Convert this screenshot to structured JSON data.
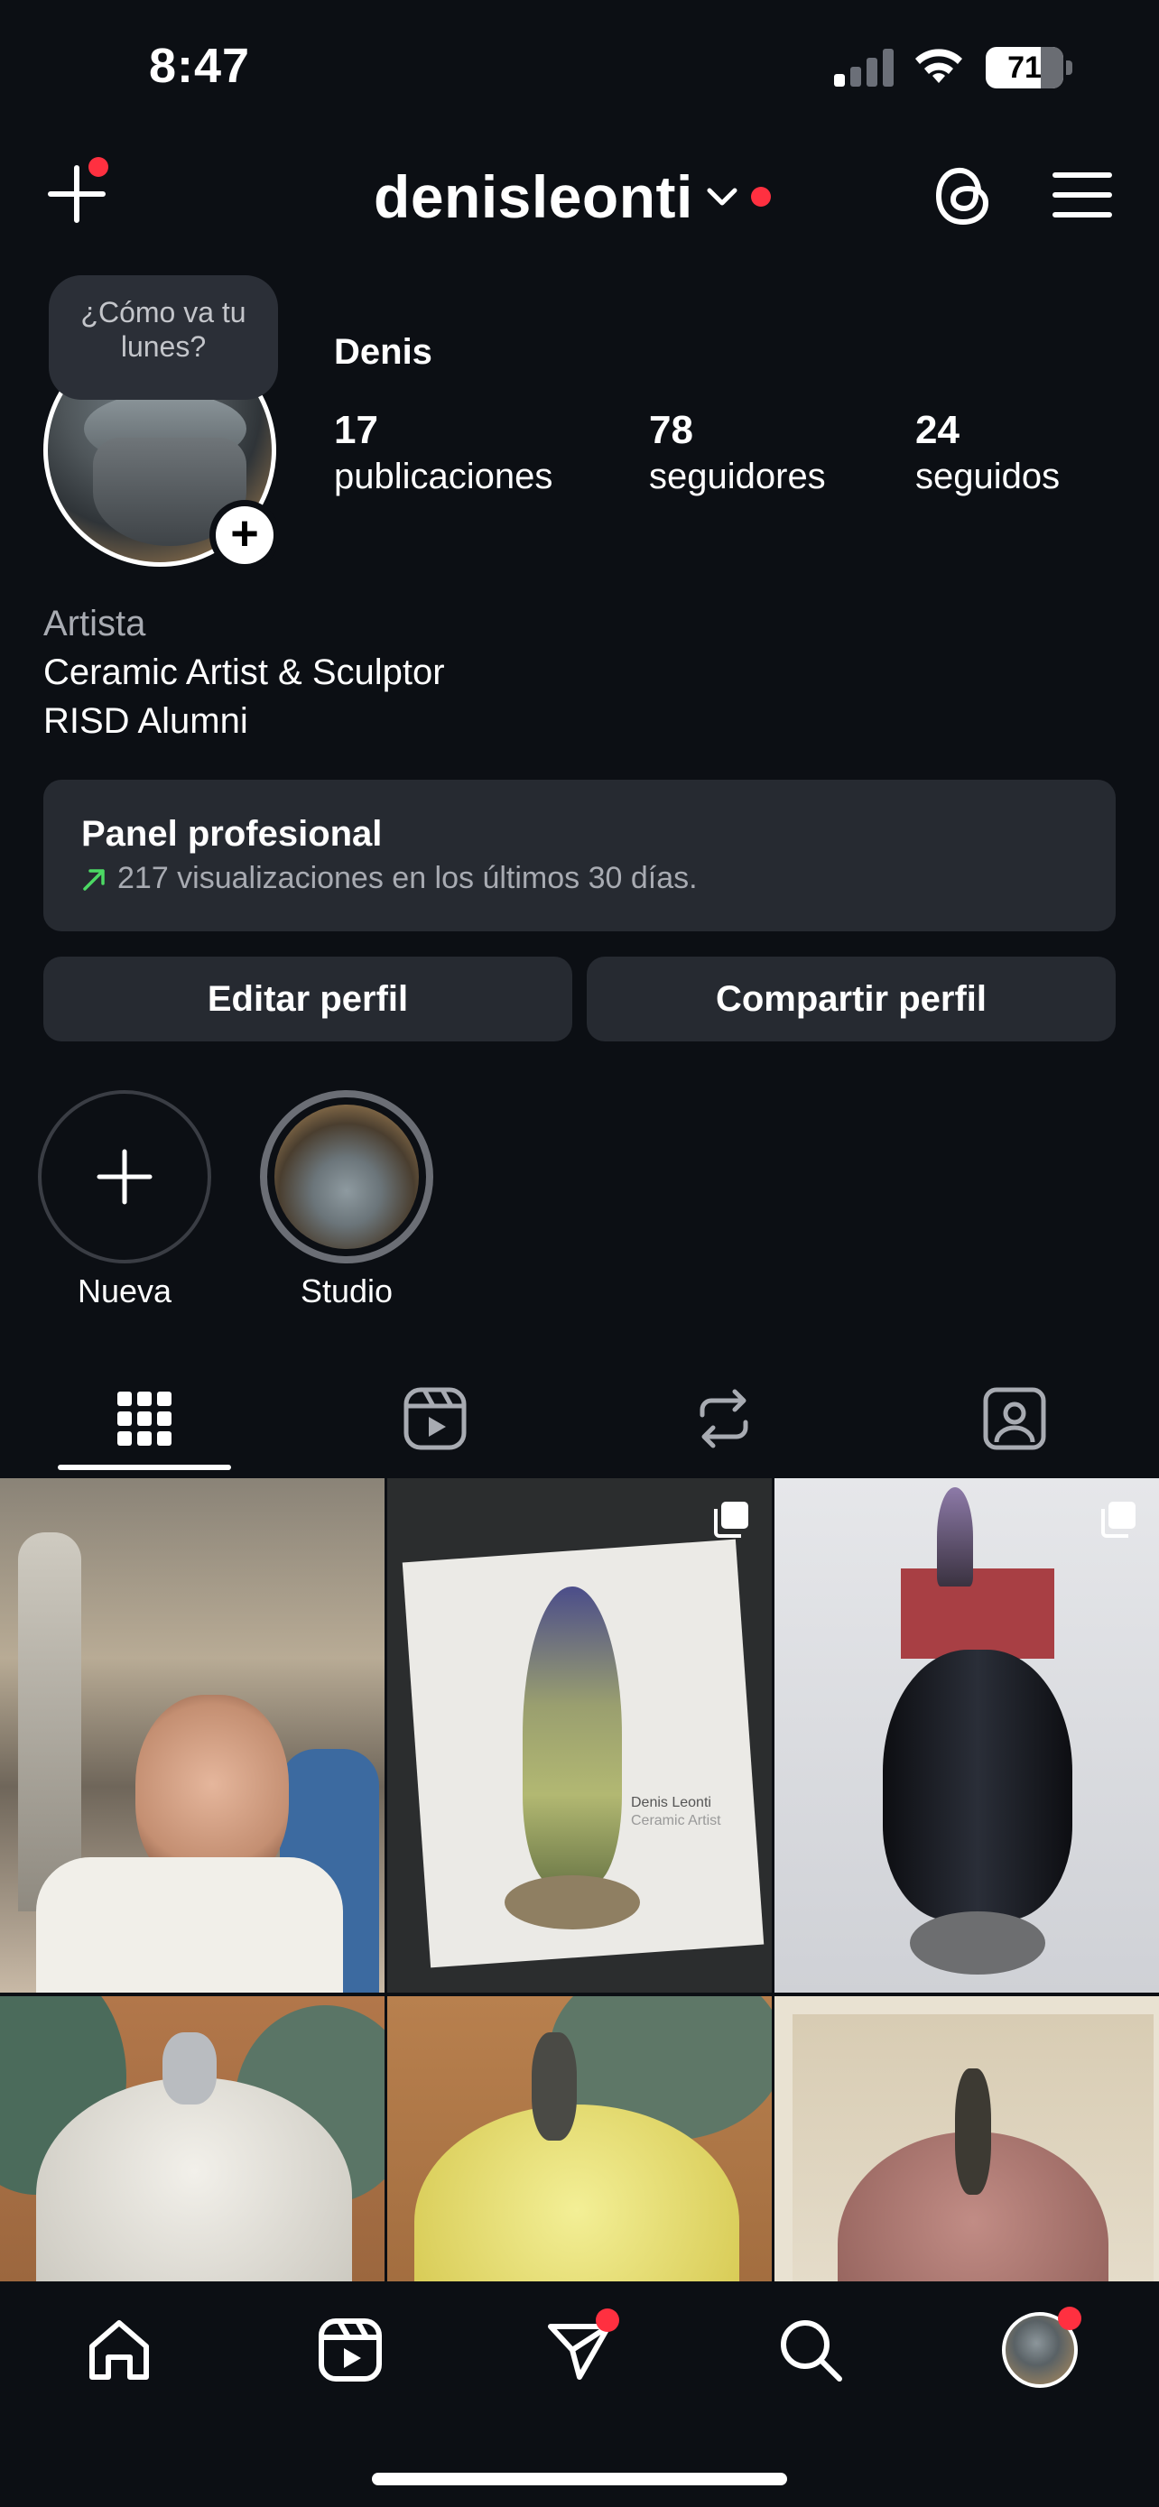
{
  "status_bar": {
    "time": "8:47",
    "battery_percent": "71"
  },
  "header": {
    "username": "denisleonti"
  },
  "profile": {
    "note": "¿Cómo va tu lunes?",
    "display_name": "Denis",
    "stats": [
      {
        "value": "17",
        "label": "publicaciones"
      },
      {
        "value": "78",
        "label": "seguidores"
      },
      {
        "value": "24",
        "label": "seguidos"
      }
    ],
    "bio": {
      "category": "Artista",
      "line1": "Ceramic Artist & Sculptor",
      "line2": "RISD Alumni"
    }
  },
  "panel": {
    "title": "Panel profesional",
    "subtitle": "217 visualizaciones en los últimos 30 días."
  },
  "buttons": {
    "edit": "Editar perfil",
    "share": "Compartir perfil"
  },
  "highlights": [
    {
      "label": "Nueva"
    },
    {
      "label": "Studio"
    }
  ],
  "grid": {
    "tile2_text_line1": "Denis Leonti",
    "tile2_text_line2": "Ceramic Artist"
  },
  "colors": {
    "accent_red": "#ff3040",
    "background": "#0c0f14",
    "surface": "#262a31",
    "trend_green": "#4cd964"
  },
  "icons": [
    "plus-icon",
    "chevron-down-icon",
    "threads-icon",
    "hamburger-menu-icon",
    "grid-icon",
    "reels-icon",
    "repost-icon",
    "tagged-icon",
    "home-icon",
    "send-icon",
    "search-icon",
    "multi-photo-icon"
  ]
}
